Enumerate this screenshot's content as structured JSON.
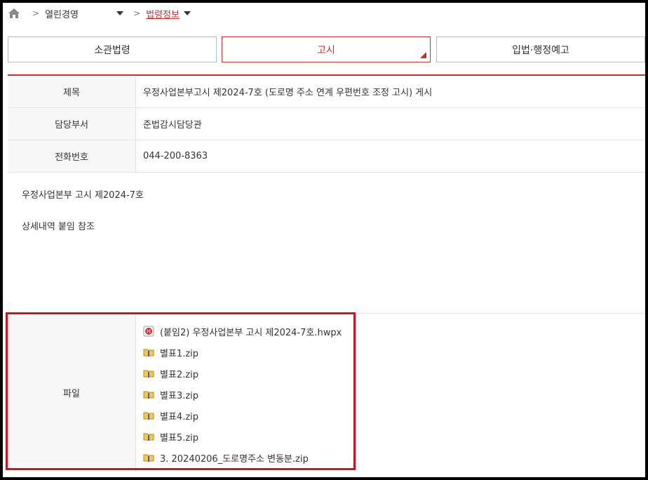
{
  "breadcrumb": {
    "level1": "열린경영",
    "level2": "법령정보",
    "separator": ">"
  },
  "tabs": [
    {
      "label": "소관법령",
      "active": false
    },
    {
      "label": "고시",
      "active": true
    },
    {
      "label": "입법·행정예고",
      "active": false
    }
  ],
  "info": {
    "title_label": "제목",
    "title_value": "우정사업본부고시 제2024-7호 (도로명 주소 연계 우편번호 조정 고시) 게시",
    "dept_label": "담당부서",
    "dept_value": "준법감시담당관",
    "phone_label": "전화번호",
    "phone_value": "044-200-8363"
  },
  "content": {
    "line1": "우정사업본부 고시 제2024-7호",
    "line2": "상세내역 붙임 참조"
  },
  "files": {
    "label": "파일",
    "items": [
      {
        "name": "(붙임2) 우정사업본부 고시 제2024-7호.hwpx",
        "icon": "hwp-file-icon"
      },
      {
        "name": "별표1.zip",
        "icon": "zip-file-icon"
      },
      {
        "name": "별표2.zip",
        "icon": "zip-file-icon"
      },
      {
        "name": "별표3.zip",
        "icon": "zip-file-icon"
      },
      {
        "name": "별표4.zip",
        "icon": "zip-file-icon"
      },
      {
        "name": "별표5.zip",
        "icon": "zip-file-icon"
      },
      {
        "name": "3. 20240206_도로명주소 변동분.zip",
        "icon": "zip-file-icon"
      }
    ]
  },
  "colors": {
    "accent": "#c8302f",
    "highlight": "#d1111d"
  }
}
